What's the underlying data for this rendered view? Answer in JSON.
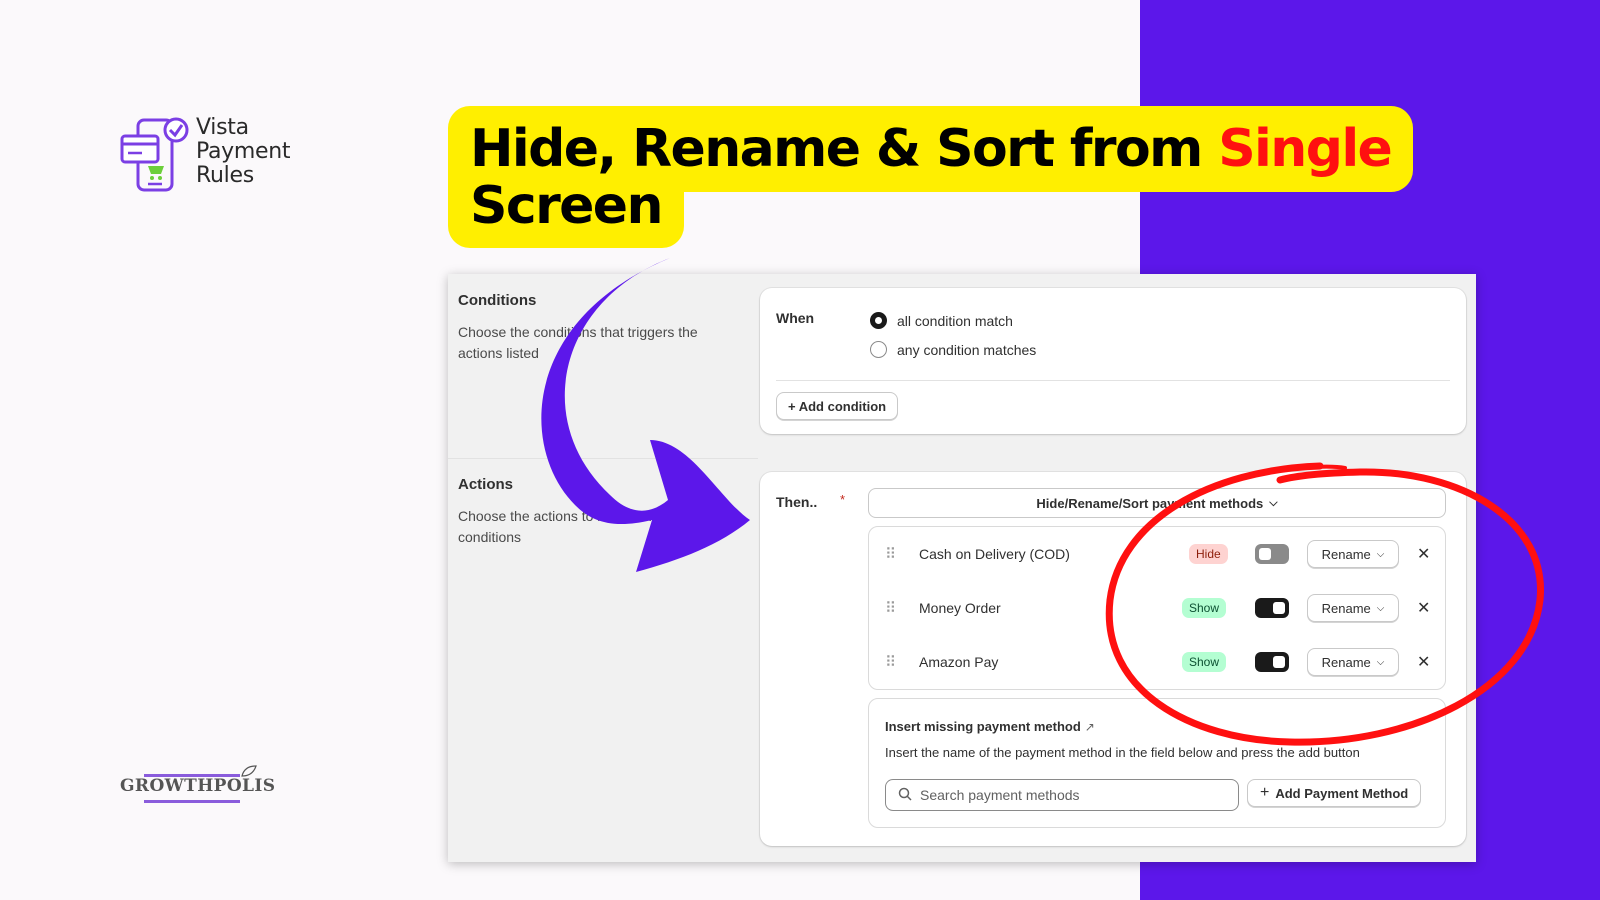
{
  "brand": {
    "logo_lines": [
      "Vista",
      "Payment",
      "Rules"
    ],
    "footer_logo": "GROWTHPOLIS"
  },
  "headline": {
    "part1": "Hide, Rename & Sort from ",
    "highlight": "Single",
    "part2": "Screen"
  },
  "colors": {
    "accent_purple": "#5c17ea",
    "headline_bg": "#ffef00",
    "highlight_red": "#ff1010",
    "annotation_red": "#ff1010"
  },
  "conditions": {
    "title": "Conditions",
    "description": "Choose the conditions that triggers the actions listed",
    "when_label": "When",
    "options": [
      {
        "label": "all condition match",
        "selected": true
      },
      {
        "label": "any condition matches",
        "selected": false
      }
    ],
    "add_button": "+ Add condition"
  },
  "actions": {
    "title": "Actions",
    "description": "Choose the actions to be performed on conditions",
    "then_label": "Then..",
    "required_mark": "*",
    "select_value": "Hide/Rename/Sort payment methods",
    "methods": [
      {
        "name": "Cash on Delivery (COD)",
        "status": "Hide",
        "enabled": false,
        "rename_label": "Rename"
      },
      {
        "name": "Money Order",
        "status": "Show",
        "enabled": true,
        "rename_label": "Rename"
      },
      {
        "name": "Amazon Pay",
        "status": "Show",
        "enabled": true,
        "rename_label": "Rename"
      }
    ],
    "insert": {
      "title": "Insert missing payment method",
      "description": "Insert the name of the payment method in the field below and press the add button",
      "search_placeholder": "Search payment methods",
      "add_button": "Add Payment Method"
    }
  },
  "icons": {
    "drag": "drag-handle-icon",
    "close": "close-icon",
    "chevron": "chevron-down-icon",
    "search": "search-icon",
    "external": "external-link-icon",
    "plus": "plus-icon"
  }
}
